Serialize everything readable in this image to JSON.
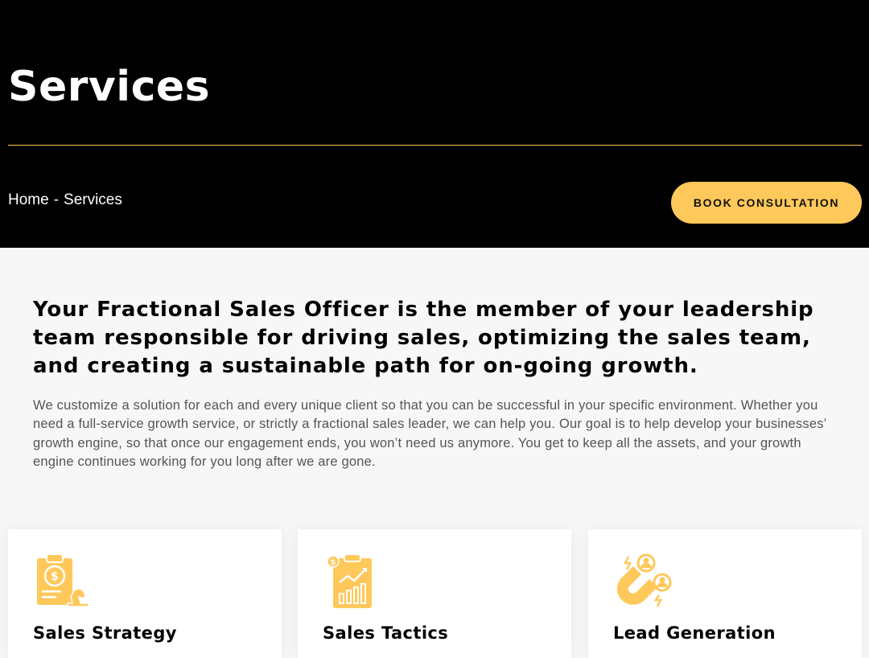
{
  "hero": {
    "title": "Services",
    "breadcrumb": {
      "home": "Home",
      "separator": "-",
      "current": "Services"
    },
    "cta_label": "BOOK CONSULTATION"
  },
  "intro": {
    "heading": "Your Fractional Sales Officer is the member of your leadership team responsible for driving sales, optimizing the sales team, and creating a sustainable path for on-going growth.",
    "body": "We customize a solution for each and every unique client so that you can be successful in your specific environment. Whether you need a full-service growth service, or strictly a fractional sales leader, we can help you. Our goal is to help develop your businesses’ growth engine, so that once our engagement ends, you won’t need us anymore. You get to keep all the assets, and your growth engine continues working for you long after we are gone."
  },
  "services": [
    {
      "title": "Sales Strategy",
      "icon": "strategy-clipboard-icon"
    },
    {
      "title": "Sales Tactics",
      "icon": "growth-chart-clipboard-icon"
    },
    {
      "title": "Lead Generation",
      "icon": "magnet-people-icon"
    }
  ],
  "colors": {
    "accent": "#ffc85a",
    "hero_bg": "#000000",
    "page_bg": "#f7f7f7"
  }
}
